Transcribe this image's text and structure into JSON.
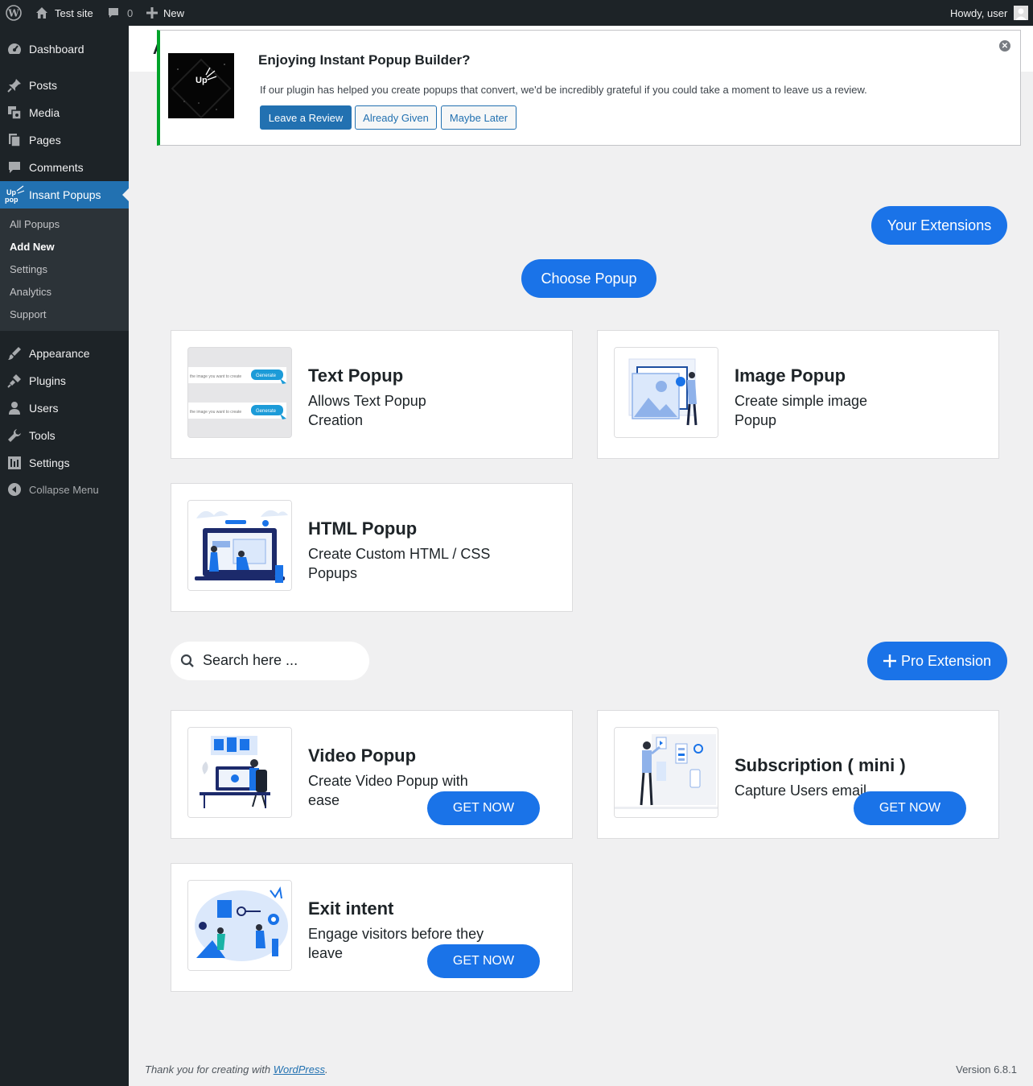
{
  "adminbar": {
    "site_name": "Test site",
    "comments_count": "0",
    "new_label": "New",
    "greeting": "Howdy, user"
  },
  "sidebar": {
    "items": [
      {
        "label": "Dashboard",
        "icon": "dashboard-icon"
      },
      {
        "label": "Posts",
        "icon": "pin-icon"
      },
      {
        "label": "Media",
        "icon": "media-icon"
      },
      {
        "label": "Pages",
        "icon": "pages-icon"
      },
      {
        "label": "Comments",
        "icon": "comment-icon"
      },
      {
        "label": "Insant Popups",
        "icon": "uppop-logo-icon"
      },
      {
        "label": "Appearance",
        "icon": "brush-icon"
      },
      {
        "label": "Plugins",
        "icon": "plug-icon"
      },
      {
        "label": "Users",
        "icon": "user-icon"
      },
      {
        "label": "Tools",
        "icon": "wrench-icon"
      },
      {
        "label": "Settings",
        "icon": "settings-icon"
      }
    ],
    "submenu": [
      "All Popups",
      "Add New",
      "Settings",
      "Analytics",
      "Support"
    ],
    "collapse_label": "Collapse Menu"
  },
  "page": {
    "partial_title": "A"
  },
  "notice": {
    "title": "Enjoying Instant Popup Builder?",
    "text": "If our plugin has helped you create popups that convert, we'd be incredibly grateful if you could take a moment to leave us a review.",
    "leave_review": "Leave a Review",
    "already_given": "Already Given",
    "maybe_later": "Maybe Later"
  },
  "buttons": {
    "your_extensions": "Your Extensions",
    "choose_popup": "Choose Popup",
    "pro_extension": "Pro Extension",
    "get_now": "GET NOW"
  },
  "popup_types": [
    {
      "title": "Text Popup",
      "desc": "Allows Text Popup Creation"
    },
    {
      "title": "Image Popup",
      "desc": "Create simple image Popup"
    },
    {
      "title": "HTML Popup",
      "desc": "Create Custom HTML / CSS Popups"
    }
  ],
  "search": {
    "placeholder": "Search here ..."
  },
  "extensions": [
    {
      "title": "Video Popup",
      "desc": "Create Video Popup with ease"
    },
    {
      "title": "Subscription ( mini )",
      "desc": "Capture Users email"
    },
    {
      "title": "Exit intent",
      "desc": "Engage visitors before they leave"
    }
  ],
  "thumb_text": {
    "generate": "Generate",
    "input_hint": "the image you want to create"
  },
  "logo_text": "Up",
  "footer": {
    "thanks_prefix": "Thank you for creating with ",
    "wp_link": "WordPress",
    "thanks_suffix": ".",
    "version": "Version 6.8.1"
  },
  "colors": {
    "admin_bar": "#1d2327",
    "accent_blue": "#1a73e8",
    "wp_blue": "#2271b1",
    "notice_green": "#00a32a"
  }
}
